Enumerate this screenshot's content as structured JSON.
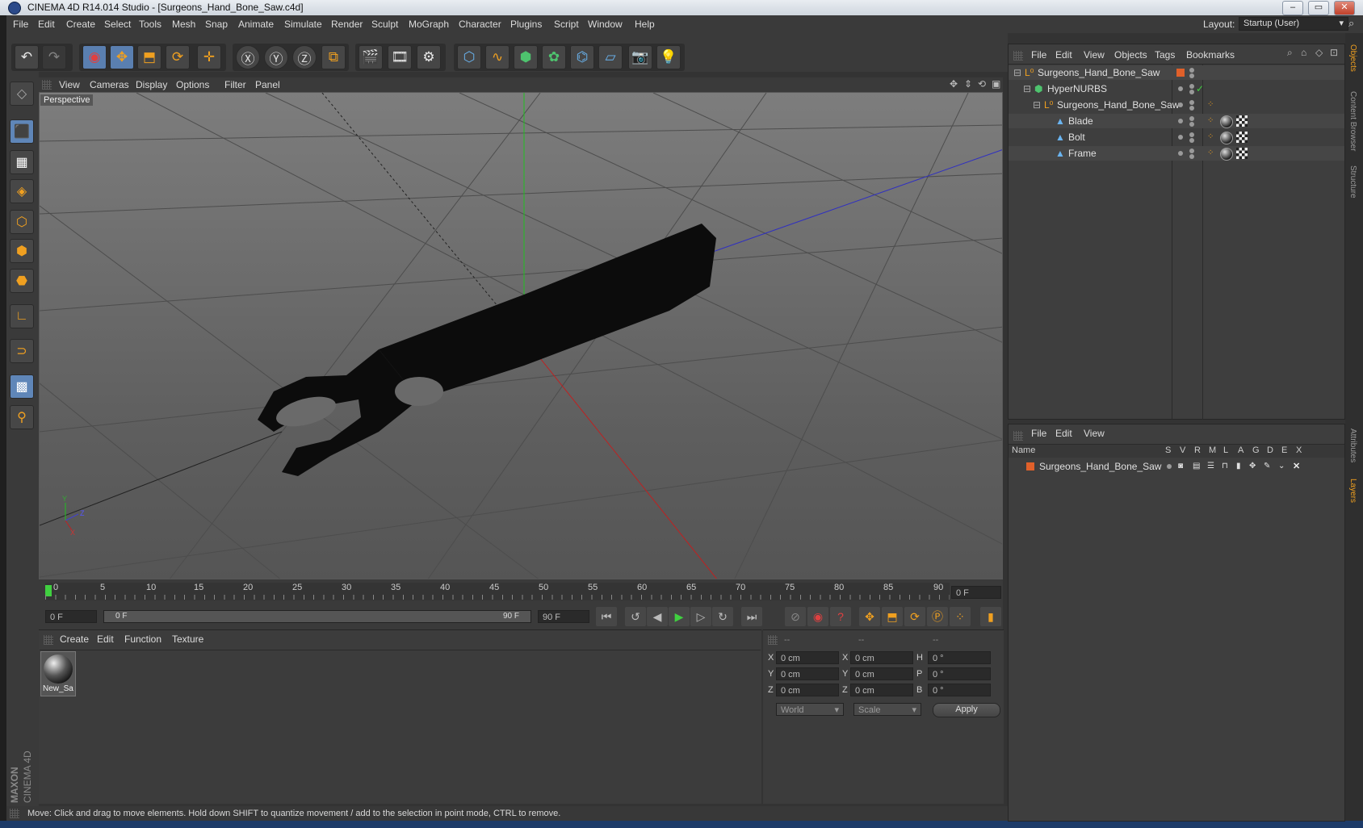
{
  "window": {
    "title": "CINEMA 4D R14.014 Studio - [Surgeons_Hand_Bone_Saw.c4d]",
    "minimize": "–",
    "restore": "▭",
    "close": "✕"
  },
  "menubar": {
    "items": [
      "File",
      "Edit",
      "Create",
      "Select",
      "Tools",
      "Mesh",
      "Snap",
      "Animate",
      "Simulate",
      "Render",
      "Sculpt",
      "MoGraph",
      "Character",
      "Plugins",
      "Script",
      "Window",
      "Help"
    ],
    "layout_label": "Layout:",
    "layout_value": "Startup (User)"
  },
  "viewport": {
    "menu": [
      "View",
      "Cameras",
      "Display",
      "Options",
      "Filter",
      "Panel"
    ],
    "label": "Perspective",
    "axis_x": "X",
    "axis_y": "Y",
    "axis_z": "Z"
  },
  "timeline": {
    "ticks": [
      "0",
      "5",
      "10",
      "15",
      "20",
      "25",
      "30",
      "35",
      "40",
      "45",
      "50",
      "55",
      "60",
      "65",
      "70",
      "75",
      "80",
      "85",
      "90"
    ],
    "current_frame": "0 F",
    "start_field": "0 F",
    "range_start": "0 F",
    "range_end": "90 F",
    "end_field": "90 F"
  },
  "material_panel": {
    "menu": [
      "Create",
      "Edit",
      "Function",
      "Texture"
    ],
    "materials": [
      {
        "name": "New_Sa"
      }
    ]
  },
  "coord_panel": {
    "headers": [
      "--",
      "--",
      "--"
    ],
    "rows": [
      {
        "a": "X",
        "av": "0 cm",
        "b": "X",
        "bv": "0 cm",
        "c": "H",
        "cv": "0 °"
      },
      {
        "a": "Y",
        "av": "0 cm",
        "b": "Y",
        "bv": "0 cm",
        "c": "P",
        "cv": "0 °"
      },
      {
        "a": "Z",
        "av": "0 cm",
        "b": "Z",
        "bv": "0 cm",
        "c": "B",
        "cv": "0 °"
      }
    ],
    "mode_select": "World",
    "scale_select": "Scale",
    "apply": "Apply"
  },
  "object_manager": {
    "menu": [
      "File",
      "Edit",
      "View",
      "Objects",
      "Tags",
      "Bookmarks"
    ],
    "objects": [
      {
        "name": "Surgeons_Hand_Bone_Saw"
      },
      {
        "name": "HyperNURBS"
      },
      {
        "name": "Surgeons_Hand_Bone_Saw"
      },
      {
        "name": "Blade"
      },
      {
        "name": "Bolt"
      },
      {
        "name": "Frame"
      }
    ]
  },
  "layer_manager": {
    "menu": [
      "File",
      "Edit",
      "View"
    ],
    "columns": [
      "Name",
      "S",
      "V",
      "R",
      "M",
      "L",
      "A",
      "G",
      "D",
      "E",
      "X"
    ],
    "layers": [
      {
        "name": "Surgeons_Hand_Bone_Saw"
      }
    ]
  },
  "right_tabs": [
    "Objects",
    "Content Browser",
    "Structure",
    "Attributes",
    "Layers"
  ],
  "brand": {
    "line1": "MAXON",
    "line2": "CINEMA 4D"
  },
  "status": "Move: Click and drag to move elements. Hold down SHIFT to quantize movement / add to the selection in point mode, CTRL to remove.",
  "colors": {
    "accent_orange": "#f0a020",
    "selection_blue": "#5a7fb0",
    "x_axis": "#c02020",
    "y_axis": "#20c020",
    "z_axis": "#3030c0"
  }
}
